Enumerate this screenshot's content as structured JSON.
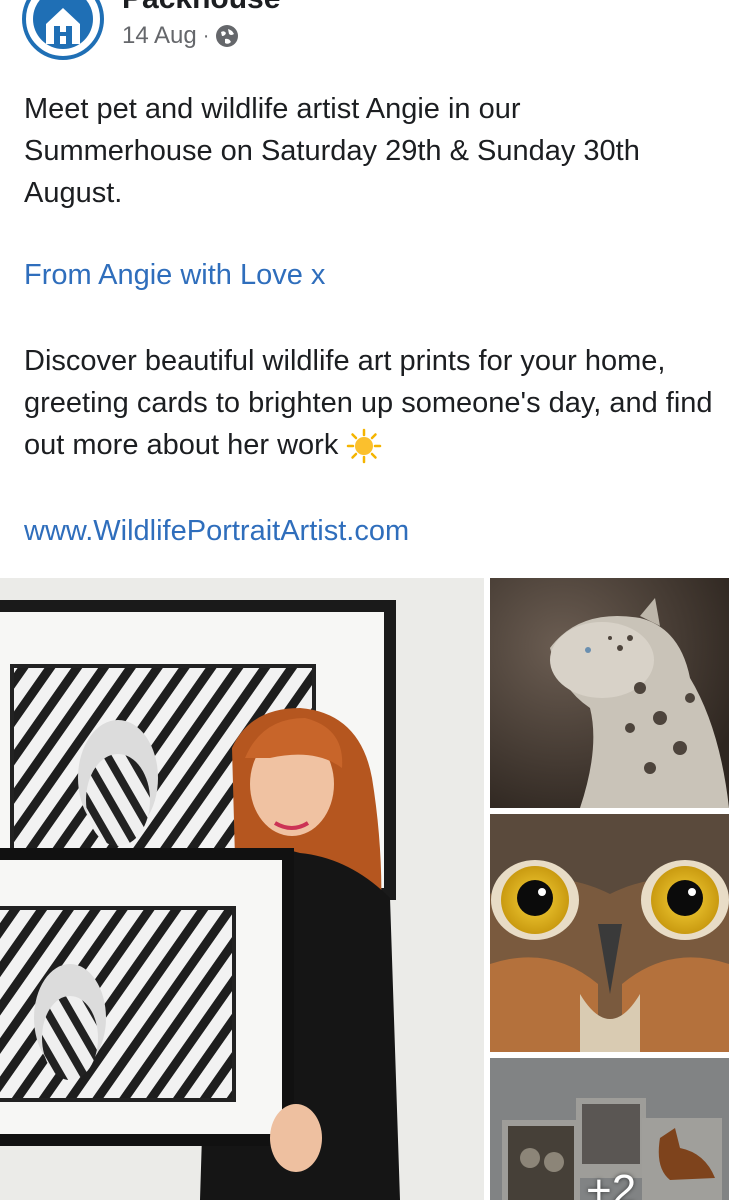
{
  "header": {
    "page_name": "Packhouse",
    "date": "14 Aug",
    "separator": "·"
  },
  "post": {
    "paragraph1": "Meet pet and wildlife artist Angie in our Summerhouse on Saturday 29th & Sunday 30th August.",
    "link1": "From Angie with Love x",
    "paragraph2": "Discover beautiful wildlife art prints for your home, greeting cards to brighten up someone's day, and find out more about her work",
    "link2": "www.WildlifePortraitArtist.com"
  },
  "photos": {
    "more_count": "+2"
  },
  "colors": {
    "link": "#2f6ebc",
    "avatar_ring": "#1f6fb5",
    "meta_text": "#65676b"
  }
}
